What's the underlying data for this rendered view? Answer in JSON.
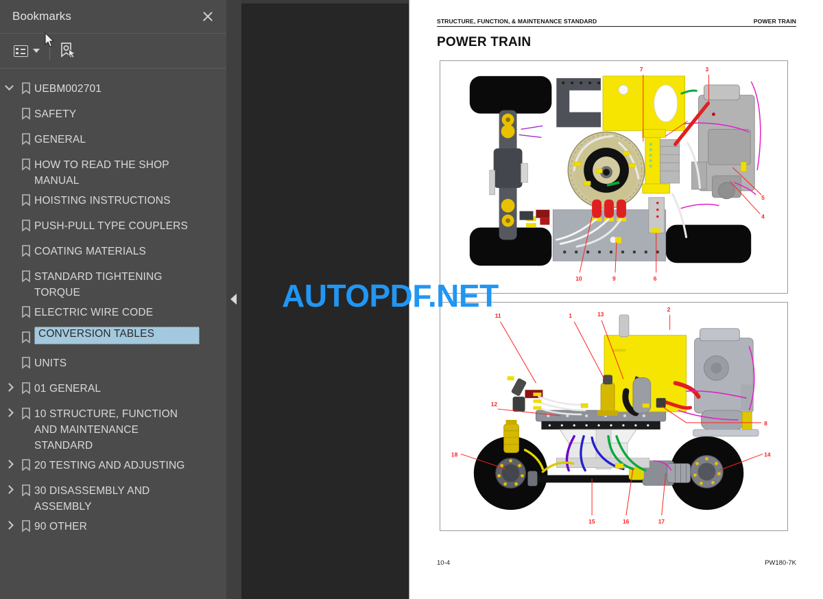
{
  "sidebar": {
    "title": "Bookmarks",
    "close_icon": "close-icon",
    "toolbar": {
      "options_icon": "list-options-icon",
      "options_caret": "chevron-down-icon",
      "new_bookmark_icon": "new-bookmark-icon"
    },
    "root": {
      "label": "UEBM002701",
      "expanded": true
    },
    "items": [
      {
        "label": "SAFETY",
        "expandable": false,
        "selected": false
      },
      {
        "label": "GENERAL",
        "expandable": false,
        "selected": false
      },
      {
        "label": "HOW TO READ THE SHOP\nMANUAL",
        "expandable": false,
        "selected": false
      },
      {
        "label": "HOISTING INSTRUCTIONS",
        "expandable": false,
        "selected": false
      },
      {
        "label": "PUSH-PULL TYPE COUPLERS",
        "expandable": false,
        "selected": false
      },
      {
        "label": "COATING MATERIALS",
        "expandable": false,
        "selected": false
      },
      {
        "label": "STANDARD TIGHTENING\nTORQUE",
        "expandable": false,
        "selected": false
      },
      {
        "label": "ELECTRIC WIRE CODE",
        "expandable": false,
        "selected": false
      },
      {
        "label": "CONVERSION TABLES",
        "expandable": false,
        "selected": true
      },
      {
        "label": "UNITS",
        "expandable": false,
        "selected": false
      },
      {
        "label": "01 GENERAL",
        "expandable": true,
        "selected": false
      },
      {
        "label": "10 STRUCTURE, FUNCTION\nAND MAINTENANCE\nSTANDARD",
        "expandable": true,
        "selected": false
      },
      {
        "label": "20 TESTING AND ADJUSTING",
        "expandable": true,
        "selected": false
      },
      {
        "label": "30 DISASSEMBLY AND\nASSEMBLY",
        "expandable": true,
        "selected": false
      },
      {
        "label": "90 OTHER",
        "expandable": true,
        "selected": false
      }
    ]
  },
  "viewer": {
    "collapse_handle_icon": "collapse-left-icon",
    "watermark": "AUTOPDF.NET",
    "watermark_color": "#2196f3"
  },
  "document": {
    "header_left": "STRUCTURE, FUNCTION, & MAINTENANCE STANDARD",
    "header_right": "POWER TRAIN",
    "title": "POWER TRAIN",
    "footer_left": "10-4",
    "footer_right": "PW180-7K",
    "figures": [
      {
        "name": "power-train-top-view",
        "callouts": [
          "7",
          "3",
          "5",
          "4",
          "10",
          "9",
          "6"
        ]
      },
      {
        "name": "power-train-side-view",
        "callouts": [
          "13",
          "2",
          "1",
          "11",
          "12",
          "8",
          "18",
          "14",
          "15",
          "16",
          "17"
        ]
      }
    ]
  },
  "colors": {
    "sidebar_bg": "#4b4b4b",
    "viewer_bg": "#262626",
    "selection": "#a3c9de",
    "accent_blue": "#2196f3",
    "callout_red": "#ff2020",
    "machine_yellow": "#f5e500"
  }
}
